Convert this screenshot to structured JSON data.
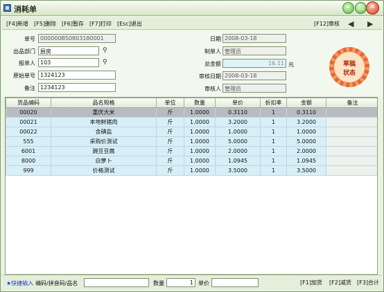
{
  "window": {
    "title": "消耗单"
  },
  "toolbar": {
    "items": [
      "[F4]新增",
      "[F5]删除",
      "[F6]暂存",
      "[F7]打印",
      "[Esc]退出"
    ],
    "audit": "[F12]审核",
    "prev": "◀",
    "next": "▶"
  },
  "form": {
    "order_no": {
      "label": "单号",
      "value": "000000BS0803180001"
    },
    "out_dept": {
      "label": "出品部门",
      "value": "厨房"
    },
    "reporter": {
      "label": "报单人",
      "value": "103"
    },
    "orig_no": {
      "label": "原始单号",
      "value": "1324123"
    },
    "remark": {
      "label": "备注",
      "value": "1234123"
    },
    "date": {
      "label": "日期",
      "value": "2008-03-18"
    },
    "creator": {
      "label": "制单人",
      "value": "管理员"
    },
    "total": {
      "label": "总金额",
      "value": "16.11",
      "unit": "元"
    },
    "audit_date": {
      "label": "审核日期",
      "value": "2008-03-18"
    },
    "auditor": {
      "label": "审核人",
      "value": "管理员"
    }
  },
  "stamp": {
    "line1": "草稿",
    "line2": "状态"
  },
  "grid": {
    "headers": [
      "货品编码",
      "品名规格",
      "单位",
      "数量",
      "单价",
      "折扣率",
      "金额",
      "备注"
    ],
    "rows": [
      [
        "00020",
        "重庆大米",
        "斤",
        "1.0000",
        "0.3110",
        "1",
        "0.3110",
        ""
      ],
      [
        "00021",
        "本地鲜猪肉",
        "斤",
        "1.0000",
        "3.2000",
        "1",
        "3.2000",
        ""
      ],
      [
        "00022",
        "含碘盐",
        "斤",
        "1.0000",
        "1.0000",
        "1",
        "1.0000",
        ""
      ],
      [
        "555",
        "采购价测试",
        "斤",
        "1.0000",
        "5.0000",
        "1",
        "5.0000",
        ""
      ],
      [
        "6001",
        "豌豆豆腐",
        "斤",
        "1.0000",
        "2.0000",
        "1",
        "2.0000",
        ""
      ],
      [
        "8000",
        "白萝卜",
        "斤",
        "1.0000",
        "1.0945",
        "1",
        "1.0945",
        ""
      ],
      [
        "999",
        "价格测试",
        "斤",
        "1.0000",
        "3.5000",
        "1",
        "3.5000",
        ""
      ]
    ]
  },
  "bottom": {
    "quick_label": "★快捷输入",
    "code_label": "编码/拼音码/品名",
    "qty_label": "数量",
    "qty_value": "1",
    "price_label": "单价",
    "keys": [
      "[F1]加货",
      "[F2]减货",
      "[F3]合计"
    ]
  },
  "colors": {
    "window_bg": "#eaf3e2",
    "grid_row": "#d7f0f8",
    "grid_selected": "#b8bcc2",
    "stamp": "#e7633a"
  }
}
